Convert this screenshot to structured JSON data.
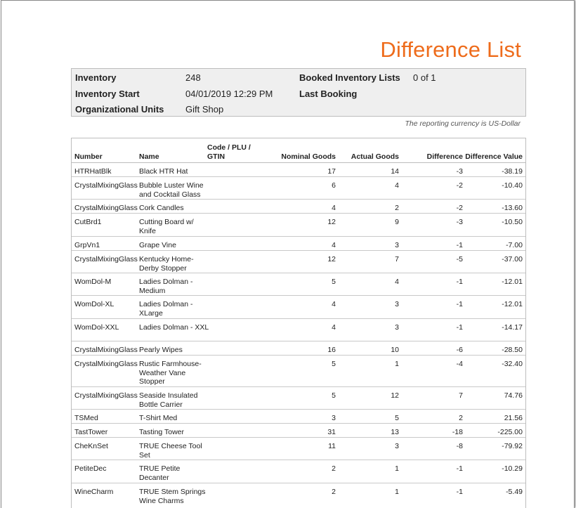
{
  "report": {
    "title": "Difference List",
    "currency_note": "The reporting currency is US-Dollar"
  },
  "info": {
    "inventory_label": "Inventory",
    "inventory_value": "248",
    "start_label": "Inventory Start",
    "start_value": "04/01/2019 12:29 PM",
    "units_label": "Organizational Units",
    "units_value": "Gift Shop",
    "booked_label": "Booked Inventory Lists",
    "booked_value": "0 of 1",
    "last_booking_label": "Last Booking",
    "last_booking_value": ""
  },
  "table": {
    "headers": {
      "number": "Number",
      "name": "Name",
      "code": "Code / PLU / GTIN",
      "nominal": "Nominal Goods",
      "actual": "Actual Goods",
      "difference": "Difference",
      "difference_value": "Difference Value"
    },
    "rows": [
      {
        "number": "HTRHatBlk",
        "name": "Black HTR Hat",
        "code": "",
        "nominal": "17",
        "actual": "14",
        "difference": "-3",
        "value": "-38.19"
      },
      {
        "number": "CrystalMixingGlass",
        "name": "Bubble Luster Wine and Cocktail Glass",
        "code": "",
        "nominal": "6",
        "actual": "4",
        "difference": "-2",
        "value": "-10.40"
      },
      {
        "number": "CrystalMixingGlass",
        "name": "Cork Candles",
        "code": "",
        "nominal": "4",
        "actual": "2",
        "difference": "-2",
        "value": "-13.60"
      },
      {
        "number": "CutBrd1",
        "name": "Cutting Board w/ Knife",
        "code": "",
        "nominal": "12",
        "actual": "9",
        "difference": "-3",
        "value": "-10.50"
      },
      {
        "number": "GrpVn1",
        "name": "Grape Vine",
        "code": "",
        "nominal": "4",
        "actual": "3",
        "difference": "-1",
        "value": "-7.00"
      },
      {
        "number": "CrystalMixingGlass",
        "name": "Kentucky Home-Derby Stopper",
        "code": "",
        "nominal": "12",
        "actual": "7",
        "difference": "-5",
        "value": "-37.00"
      },
      {
        "number": "WomDol-M",
        "name": "Ladies Dolman - Medium",
        "code": "",
        "nominal": "5",
        "actual": "4",
        "difference": "-1",
        "value": "-12.01"
      },
      {
        "number": "WomDol-XL",
        "name": "Ladies Dolman - XLarge",
        "code": "",
        "nominal": "4",
        "actual": "3",
        "difference": "-1",
        "value": "-12.01"
      },
      {
        "number": "WomDol-XXL",
        "name": "Ladies Dolman - XXL",
        "code": "",
        "nominal": "4",
        "actual": "3",
        "difference": "-1",
        "value": "-14.17"
      },
      {
        "number": "CrystalMixingGlass",
        "name": "Pearly Wipes",
        "code": "",
        "nominal": "16",
        "actual": "10",
        "difference": "-6",
        "value": "-28.50"
      },
      {
        "number": "CrystalMixingGlass",
        "name": "Rustic Farmhouse-Weather Vane Stopper",
        "code": "",
        "nominal": "5",
        "actual": "1",
        "difference": "-4",
        "value": "-32.40"
      },
      {
        "number": "CrystalMixingGlass",
        "name": "Seaside Insulated Bottle Carrier",
        "code": "",
        "nominal": "5",
        "actual": "12",
        "difference": "7",
        "value": "74.76"
      },
      {
        "number": "TSMed",
        "name": "T-Shirt Med",
        "code": "",
        "nominal": "3",
        "actual": "5",
        "difference": "2",
        "value": "21.56"
      },
      {
        "number": "TastTower",
        "name": "Tasting Tower",
        "code": "",
        "nominal": "31",
        "actual": "13",
        "difference": "-18",
        "value": "-225.00"
      },
      {
        "number": "CheKnSet",
        "name": "TRUE Cheese Tool Set",
        "code": "",
        "nominal": "11",
        "actual": "3",
        "difference": "-8",
        "value": "-79.92"
      },
      {
        "number": "PetiteDec",
        "name": "TRUE Petite Decanter",
        "code": "",
        "nominal": "2",
        "actual": "1",
        "difference": "-1",
        "value": "-10.29"
      },
      {
        "number": "WineCharm",
        "name": "TRUE Stem Springs Wine Charms",
        "code": "",
        "nominal": "2",
        "actual": "1",
        "difference": "-1",
        "value": "-5.49"
      }
    ]
  }
}
